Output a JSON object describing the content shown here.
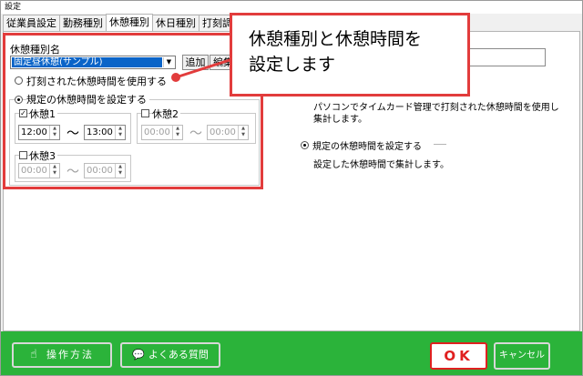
{
  "window": {
    "title": "設定"
  },
  "tabs": [
    {
      "label": "従業員設定"
    },
    {
      "label": "勤務種別"
    },
    {
      "label": "休憩種別"
    },
    {
      "label": "休日種別"
    },
    {
      "label": "打刻調"
    }
  ],
  "break_form": {
    "type_name_label": "休憩種別名",
    "type_selected": "固定昼休憩(サンプル)",
    "add_label": "追加",
    "edit_label": "編集",
    "radio_use_stamped": "打刻された休憩時間を使用する",
    "radio_use_fixed": "規定の休憩時間を設定する",
    "break1": {
      "label": "休憩1",
      "checked": true,
      "start": "12:00",
      "end": "13:00"
    },
    "break2": {
      "label": "休憩2",
      "checked": false,
      "start": "00:00",
      "end": "00:00"
    },
    "break3": {
      "label": "休憩3",
      "checked": false,
      "start": "00:00",
      "end": "00:00"
    },
    "tilde": "～"
  },
  "callout": {
    "line1": "休憩種別と休憩時間を",
    "line2": "設定します"
  },
  "right_panel": {
    "desc_stamped_1": "パソコンでタイムカード管理で打刻された休憩時間を使用し",
    "desc_stamped_2": "集計します。",
    "radio_fixed": "規定の休憩時間を設定する",
    "desc_fixed": "設定した休憩時間で集計します。"
  },
  "footer": {
    "howto_label": "操作方法",
    "faq_label": "よくある質問",
    "ok_label": "OK",
    "cancel_label": "キャンセル"
  },
  "colors": {
    "accent_red": "#e23c3c",
    "footer_green": "#2bb33a",
    "selection_blue": "#0a64c8"
  }
}
